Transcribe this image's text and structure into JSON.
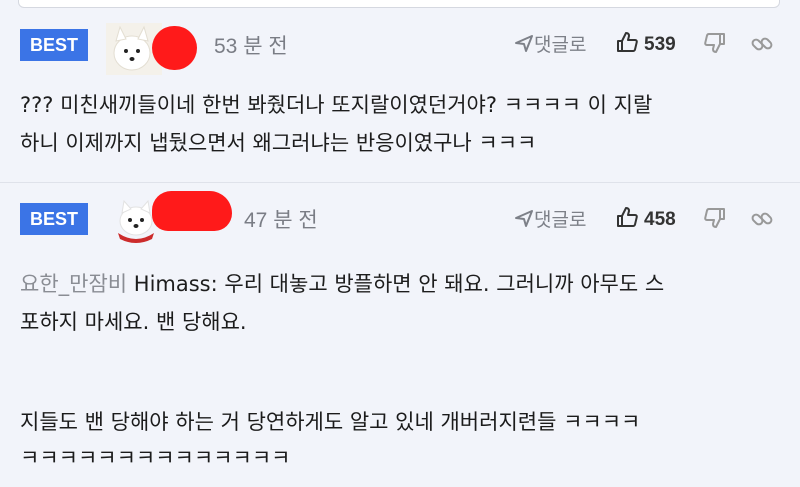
{
  "comments": [
    {
      "badge": "BEST",
      "time": "53 분 전",
      "reply_label": "댓글로",
      "likes": "539",
      "lines": [
        "??? 미친새끼들이네 한번 봐줬더나 또지랄이였던거야? ㅋㅋㅋㅋ 이 지랄",
        "하니 이제까지 냅뒀으면서 왜그러냐는 반응이였구나 ㅋㅋㅋ"
      ]
    },
    {
      "badge": "BEST",
      "time": "47 분 전",
      "reply_label": "댓글로",
      "likes": "458",
      "quote_name": "요한_만잠비",
      "quote_line1": " Himass: 우리 대놓고 방플하면 안 돼요. 그러니까 아무도 스",
      "quote_line2": "포하지 마세요. 밴 당해요.",
      "line3": "지들도 밴 당해야 하는 거 당연하게도 알고 있네 개버러지련들 ㅋㅋㅋㅋ",
      "line4": "ㅋㅋㅋㅋㅋㅋㅋㅋㅋㅋㅋㅋㅋㅋ"
    }
  ],
  "colors": {
    "badge": "#3b74e6",
    "background": "#f2f4fa",
    "redaction": "#ff1a1a"
  },
  "icons": {
    "reply": "reply-arrow-icon",
    "like": "thumbs-up-icon",
    "dislike": "thumbs-down-icon",
    "share": "link-icon"
  }
}
